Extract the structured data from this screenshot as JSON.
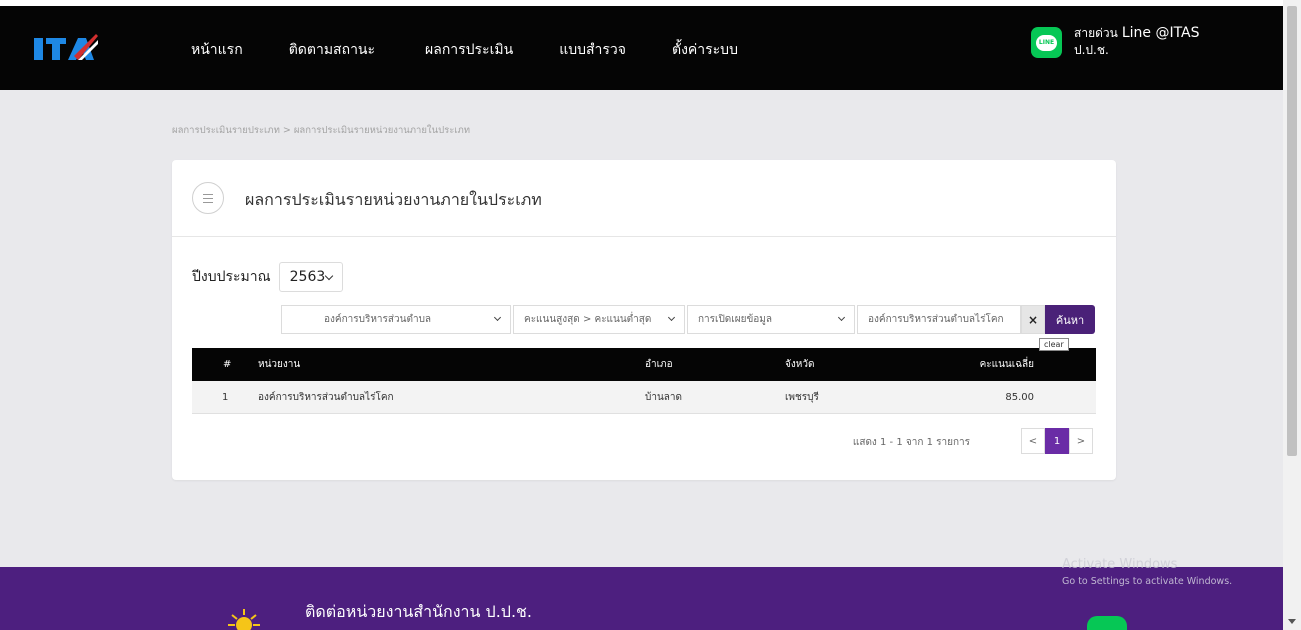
{
  "navbar": {
    "logo_text": "ITA",
    "items": [
      {
        "label": "หน้าแรก"
      },
      {
        "label": "ติดตามสถานะ"
      },
      {
        "label": "ผลการประเมิน"
      },
      {
        "label": "แบบสำรวจ"
      },
      {
        "label": "ตั้งค่าระบบ"
      }
    ],
    "line_icon_text": "LINE",
    "hotline_label": "สายด่วน",
    "line_id": "Line @ITAS",
    "org_short": "ป.ป.ช."
  },
  "breadcrumb": "ผลการประเมินรายประเภท > ผลการประเมินรายหน่วยงานภายในประเภท",
  "card": {
    "title": "ผลการประเมินรายหน่วยงานภายในประเภท",
    "year_label": "ปีงบประมาณ",
    "year_value": "2563",
    "filters": {
      "org_type": "องค์การบริหารส่วนตำบล",
      "sort": "คะแนนสูงสุด > คะแนนต่ำสุด",
      "disclosure": "การเปิดเผยข้อมูล",
      "search_value": "องค์การบริหารส่วนตำบลไร่โคก",
      "clear_label": "×",
      "search_label": "ค้นหา",
      "tooltip": "clear"
    },
    "table": {
      "headers": {
        "num": "#",
        "name": "หน่วยงาน",
        "district": "อำเภอ",
        "province": "จังหวัด",
        "score": "คะแนนเฉลี่ย"
      },
      "rows": [
        {
          "num": "1",
          "name": "องค์การบริหารส่วนตำบลไร่โคก",
          "district": "บ้านลาด",
          "province": "เพชรบุรี",
          "score": "85.00"
        }
      ]
    },
    "pagination": {
      "summary": "แสดง 1 - 1 จาก 1 รายการ",
      "prev": "<",
      "current": "1",
      "next": ">"
    }
  },
  "footer": {
    "title": "ติดต่อหน่วยงานสำนักงาน ป.ป.ช."
  },
  "watermark": {
    "line1": "Activate Windows",
    "line2": "Go to Settings to activate Windows."
  },
  "colors": {
    "navbar_bg": "#050505",
    "accent_purple": "#4a2178",
    "footer_purple": "#4d1f7f",
    "line_green": "#06c755"
  }
}
